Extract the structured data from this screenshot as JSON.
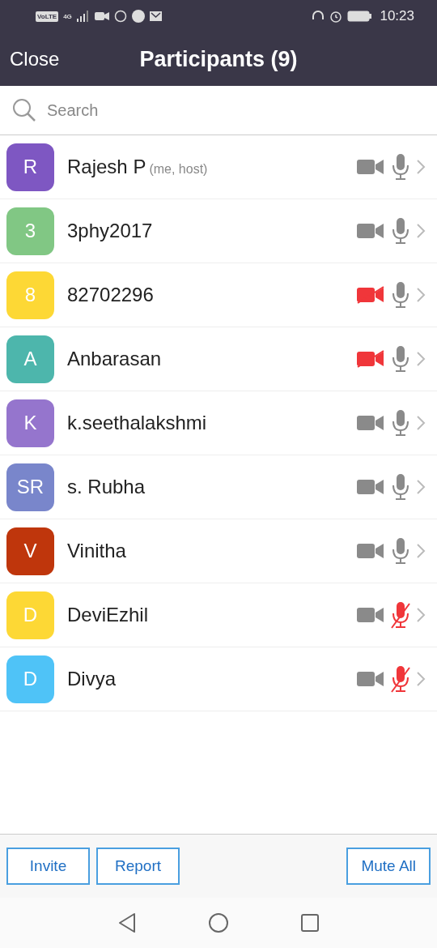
{
  "status_bar": {
    "network_badge": "VoLTE",
    "network_type": "4G",
    "time": "10:23"
  },
  "header": {
    "close": "Close",
    "title": "Participants (9)"
  },
  "search": {
    "placeholder": "Search"
  },
  "participants": [
    {
      "initials": "R",
      "color": "#7e57c2",
      "name": "Rajesh P",
      "note": "(me, host)",
      "video_off": false,
      "muted": false
    },
    {
      "initials": "3",
      "color": "#81c784",
      "name": "3phy2017",
      "video_off": false,
      "muted": false
    },
    {
      "initials": "8",
      "color": "#fdd835",
      "name": "82702296",
      "video_off": true,
      "muted": false
    },
    {
      "initials": "A",
      "color": "#4db6ac",
      "name": "Anbarasan",
      "video_off": true,
      "muted": false
    },
    {
      "initials": "K",
      "color": "#9575cd",
      "name": "k.seethalakshmi",
      "video_off": false,
      "muted": false
    },
    {
      "initials": "SR",
      "color": "#7986cb",
      "name": "s. Rubha",
      "video_off": false,
      "muted": false
    },
    {
      "initials": "V",
      "color": "#bf360c",
      "name": "Vinitha",
      "video_off": false,
      "muted": false
    },
    {
      "initials": "D",
      "color": "#fdd835",
      "name": "DeviEzhil",
      "video_off": false,
      "muted": true
    },
    {
      "initials": "D",
      "color": "#4fc3f7",
      "name": "Divya",
      "video_off": false,
      "muted": true
    }
  ],
  "footer": {
    "left_buttons": [
      "Invite",
      "Report"
    ],
    "right_button": "Mute All"
  }
}
